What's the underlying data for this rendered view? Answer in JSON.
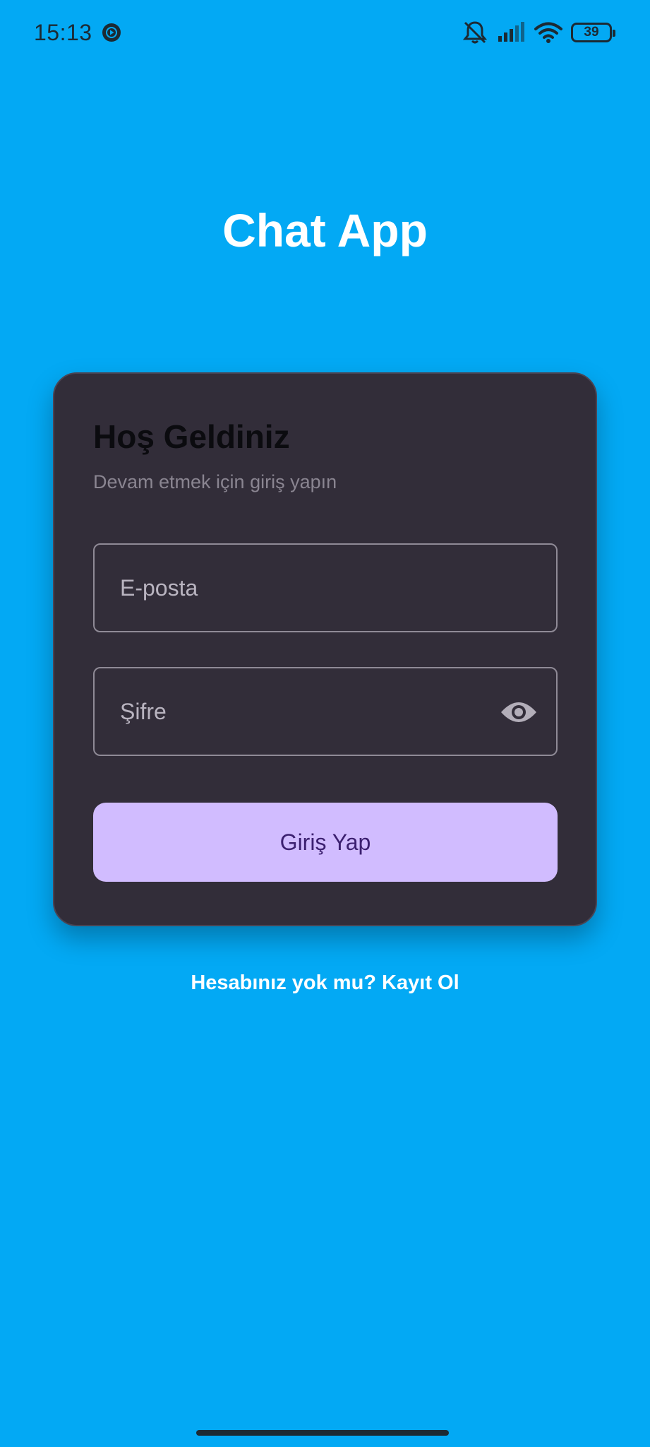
{
  "status_bar": {
    "time": "15:13",
    "battery_level": "39",
    "icons": [
      "media-playback-icon",
      "silent-mode-icon",
      "signal-strength-icon",
      "wifi-icon",
      "battery-icon"
    ]
  },
  "app": {
    "title": "Chat App"
  },
  "login_card": {
    "title": "Hoş Geldiniz",
    "subtitle": "Devam etmek için giriş yapın",
    "email_placeholder": "E-posta",
    "email_value": "",
    "password_placeholder": "Şifre",
    "password_value": "",
    "password_toggle_icon": "eye-icon",
    "login_button_label": "Giriş Yap"
  },
  "signup_link": "Hesabınız yok mu? Kayıt Ol",
  "colors": {
    "background": "#03A9F4",
    "card": "#322D39",
    "button": "#D1BCFF",
    "button_text": "#3C2070",
    "title_text": "#FFFFFF"
  }
}
